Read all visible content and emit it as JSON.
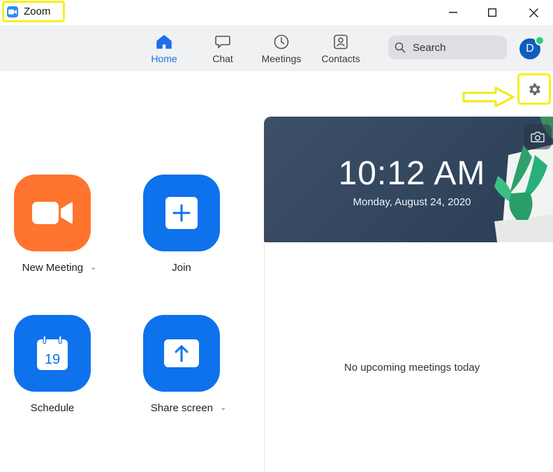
{
  "window": {
    "app_name": "Zoom",
    "controls": [
      "minimize",
      "maximize",
      "close"
    ]
  },
  "nav": {
    "tabs": [
      {
        "label": "Home",
        "icon": "home-icon",
        "active": true
      },
      {
        "label": "Chat",
        "icon": "chat-icon",
        "active": false
      },
      {
        "label": "Meetings",
        "icon": "clock-icon",
        "active": false
      },
      {
        "label": "Contacts",
        "icon": "contacts-icon",
        "active": false
      }
    ],
    "search_placeholder": "Search",
    "avatar_initial": "D"
  },
  "actions": [
    {
      "label": "New Meeting",
      "icon": "video-camera-icon",
      "color": "#ff742e",
      "has_dropdown": true
    },
    {
      "label": "Join",
      "icon": "plus-icon",
      "color": "#0e72ed",
      "has_dropdown": false
    },
    {
      "label": "Schedule",
      "icon": "calendar-icon",
      "color": "#0e72ed",
      "has_dropdown": false,
      "calendar_day": "19"
    },
    {
      "label": "Share screen",
      "icon": "share-arrow-icon",
      "color": "#0e72ed",
      "has_dropdown": true
    }
  ],
  "hero": {
    "time": "10:12 AM",
    "date": "Monday, August 24, 2020"
  },
  "meetings": {
    "empty_message": "No upcoming meetings today"
  },
  "colors": {
    "accent": "#0e72ed",
    "orange": "#ff742e",
    "highlight": "#f7f01a",
    "nav_bg": "#f0f1f3"
  }
}
